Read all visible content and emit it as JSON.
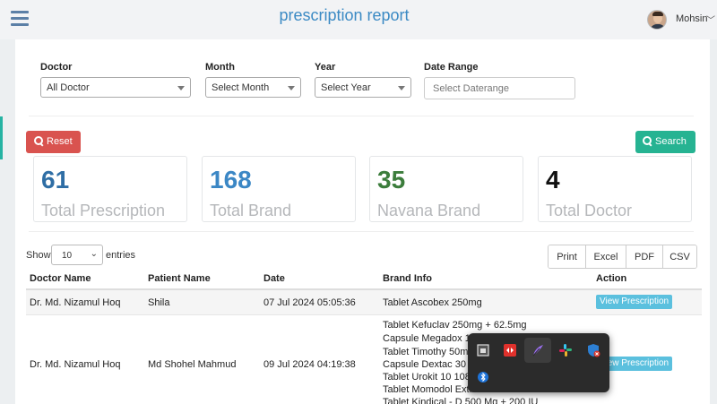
{
  "header": {
    "title": "prescription report",
    "user_name": "Mohsin",
    "menu_icon": "hamburger-icon",
    "caret": "﹀"
  },
  "filters": {
    "doctor_label": "Doctor",
    "doctor_value": "All Doctor",
    "month_label": "Month",
    "month_value": "Select Month",
    "year_label": "Year",
    "year_value": "Select Year",
    "date_range_label": "Date Range",
    "date_range_placeholder": "Select Daterange"
  },
  "buttons": {
    "reset": "Reset",
    "search": "Search"
  },
  "stats": [
    {
      "value": "61",
      "label": "Total Prescription",
      "color": "#2f6ea5"
    },
    {
      "value": "168",
      "label": "Total Brand",
      "color": "#3b87c5"
    },
    {
      "value": "35",
      "label": "Navana Brand",
      "color": "#3c7d3c"
    },
    {
      "value": "4",
      "label": "Total Doctor",
      "color": "#111111"
    }
  ],
  "table_controls": {
    "show": "Show",
    "entries_value": "10",
    "entries": "entries",
    "chevron": "⌄",
    "export": [
      "Print",
      "Excel",
      "PDF",
      "CSV"
    ]
  },
  "table": {
    "headers": [
      "Doctor Name",
      "Patient Name",
      "Date",
      "Brand Info",
      "Action"
    ],
    "rows": [
      {
        "doctor": "Dr. Md. Nizamul Hoq",
        "patient": "Shila",
        "date": "07 Jul 2024 05:05:36",
        "brands": [
          "Tablet Ascobex 250mg"
        ],
        "action": "View Prescription"
      },
      {
        "doctor": "Dr. Md. Nizamul Hoq",
        "patient": "Md Shohel Mahmud",
        "date": "09 Jul 2024 04:19:38",
        "brands": [
          "Tablet Kefuclav 250mg + 62.5mg",
          "Capsule Megadox 10",
          "Tablet Timothy 50mg",
          "Capsule Dextac 30 3",
          "Tablet Urokit 10 1080",
          "Tablet Momodol Extra",
          "Tablet Kindical - D 500 Mg + 200 IU"
        ],
        "action": "View Prescription"
      }
    ]
  },
  "tray": {
    "icons": [
      "window-app-icon",
      "anydesk-icon",
      "feather-app-icon",
      "slack-icon",
      "security-shield-icon",
      "bluetooth-icon"
    ]
  }
}
